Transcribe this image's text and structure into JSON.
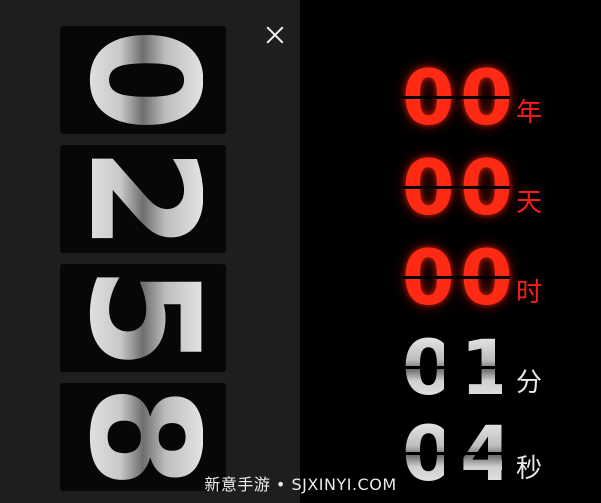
{
  "flip_clock": {
    "digits": [
      "0",
      "2",
      "5",
      "8"
    ]
  },
  "close_button": {
    "icon": "close-icon",
    "color": "#f2f2f2"
  },
  "countdown": {
    "rows": [
      {
        "digits": [
          "0",
          "0"
        ],
        "unit": "年",
        "color": "#ff2a14"
      },
      {
        "digits": [
          "0",
          "0"
        ],
        "unit": "天",
        "color": "#ff2a14"
      },
      {
        "digits": [
          "0",
          "0"
        ],
        "unit": "时",
        "color": "#ff2a14"
      },
      {
        "digits": [
          "0",
          "1"
        ],
        "unit": "分",
        "color": "#d0d0d0"
      },
      {
        "digits": [
          "0",
          "4"
        ],
        "unit": "秒",
        "color": "#d0d0d0"
      }
    ]
  },
  "watermark": "新意手游 • SJXINYI.COM"
}
